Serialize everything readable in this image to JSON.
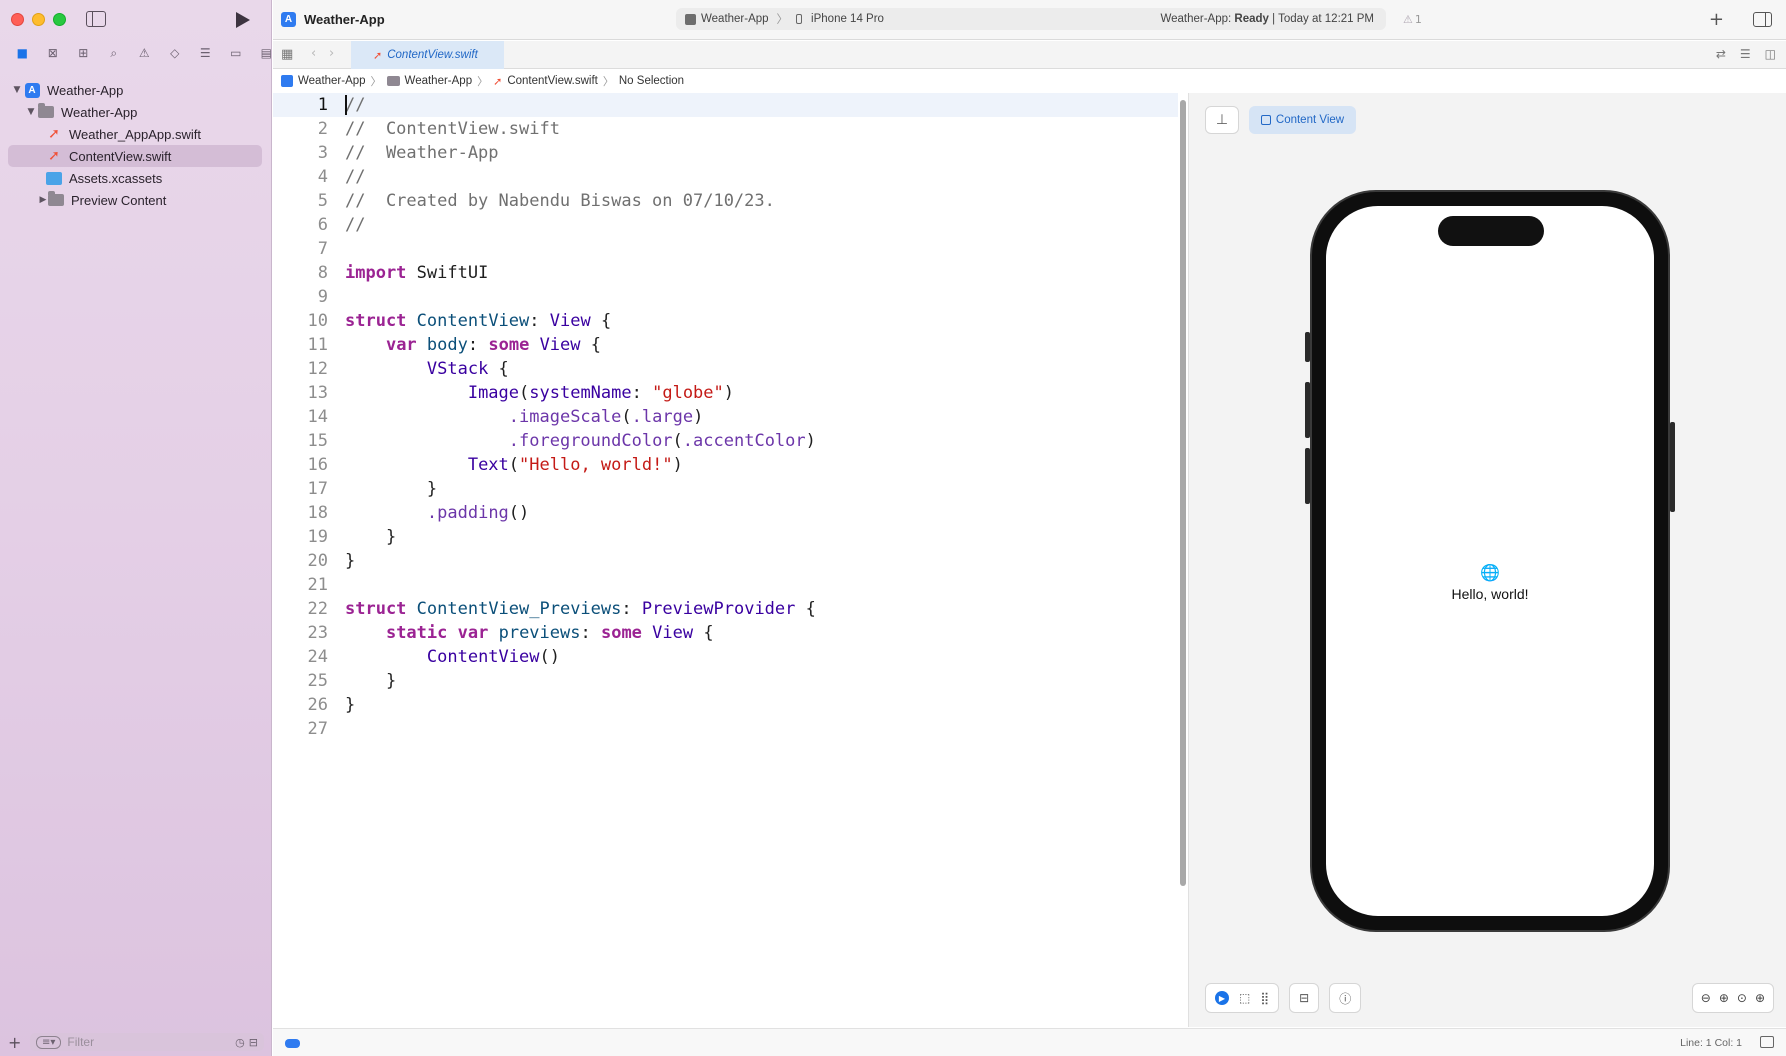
{
  "window": {
    "project_title": "Weather-App",
    "scheme": "Weather-App",
    "device": "iPhone 14 Pro",
    "status_prefix": "Weather-App: ",
    "status_state": "Ready",
    "status_time": " | Today at 12:21 PM",
    "warning_count": "1"
  },
  "sidebar": {
    "tree": [
      {
        "label": "Weather-App",
        "icon": "app-icon",
        "level": 0,
        "expanded": true
      },
      {
        "label": "Weather-App",
        "icon": "folder-icon",
        "level": 1,
        "expanded": true
      },
      {
        "label": "Weather_AppApp.swift",
        "icon": "swift-icon",
        "level": 2
      },
      {
        "label": "ContentView.swift",
        "icon": "swift-icon",
        "level": 2,
        "selected": true
      },
      {
        "label": "Assets.xcassets",
        "icon": "assets-icon",
        "level": 2
      },
      {
        "label": "Preview Content",
        "icon": "folder-icon",
        "level": 2,
        "expanded": false
      }
    ],
    "filter_placeholder": "Filter"
  },
  "tabs": [
    {
      "label": "ContentView.swift",
      "active": true
    }
  ],
  "breadcrumb": [
    "Weather-App",
    "Weather-App",
    "ContentView.swift",
    "No Selection"
  ],
  "editor": {
    "current_line": 1,
    "lines": [
      "//",
      "//  ContentView.swift",
      "//  Weather-App",
      "//",
      "//  Created by Nabendu Biswas on 07/10/23.",
      "//",
      "",
      "import SwiftUI",
      "",
      "struct ContentView: View {",
      "    var body: some View {",
      "        VStack {",
      "            Image(systemName: \"globe\")",
      "                .imageScale(.large)",
      "                .foregroundColor(.accentColor)",
      "            Text(\"Hello, world!\")",
      "        }",
      "        .padding()",
      "    }",
      "}",
      "",
      "struct ContentView_Previews: PreviewProvider {",
      "    static var previews: some View {",
      "        ContentView()",
      "    }",
      "}",
      ""
    ]
  },
  "preview": {
    "content_view_label": "Content View",
    "hello_text": "Hello, world!"
  },
  "statusbar": {
    "line_col": "Line: 1  Col: 1"
  },
  "colors": {
    "accent": "#2f7bf0",
    "swift": "#f05138",
    "keyword": "#9b2393",
    "string": "#c41a16",
    "type": "#3900a0"
  }
}
